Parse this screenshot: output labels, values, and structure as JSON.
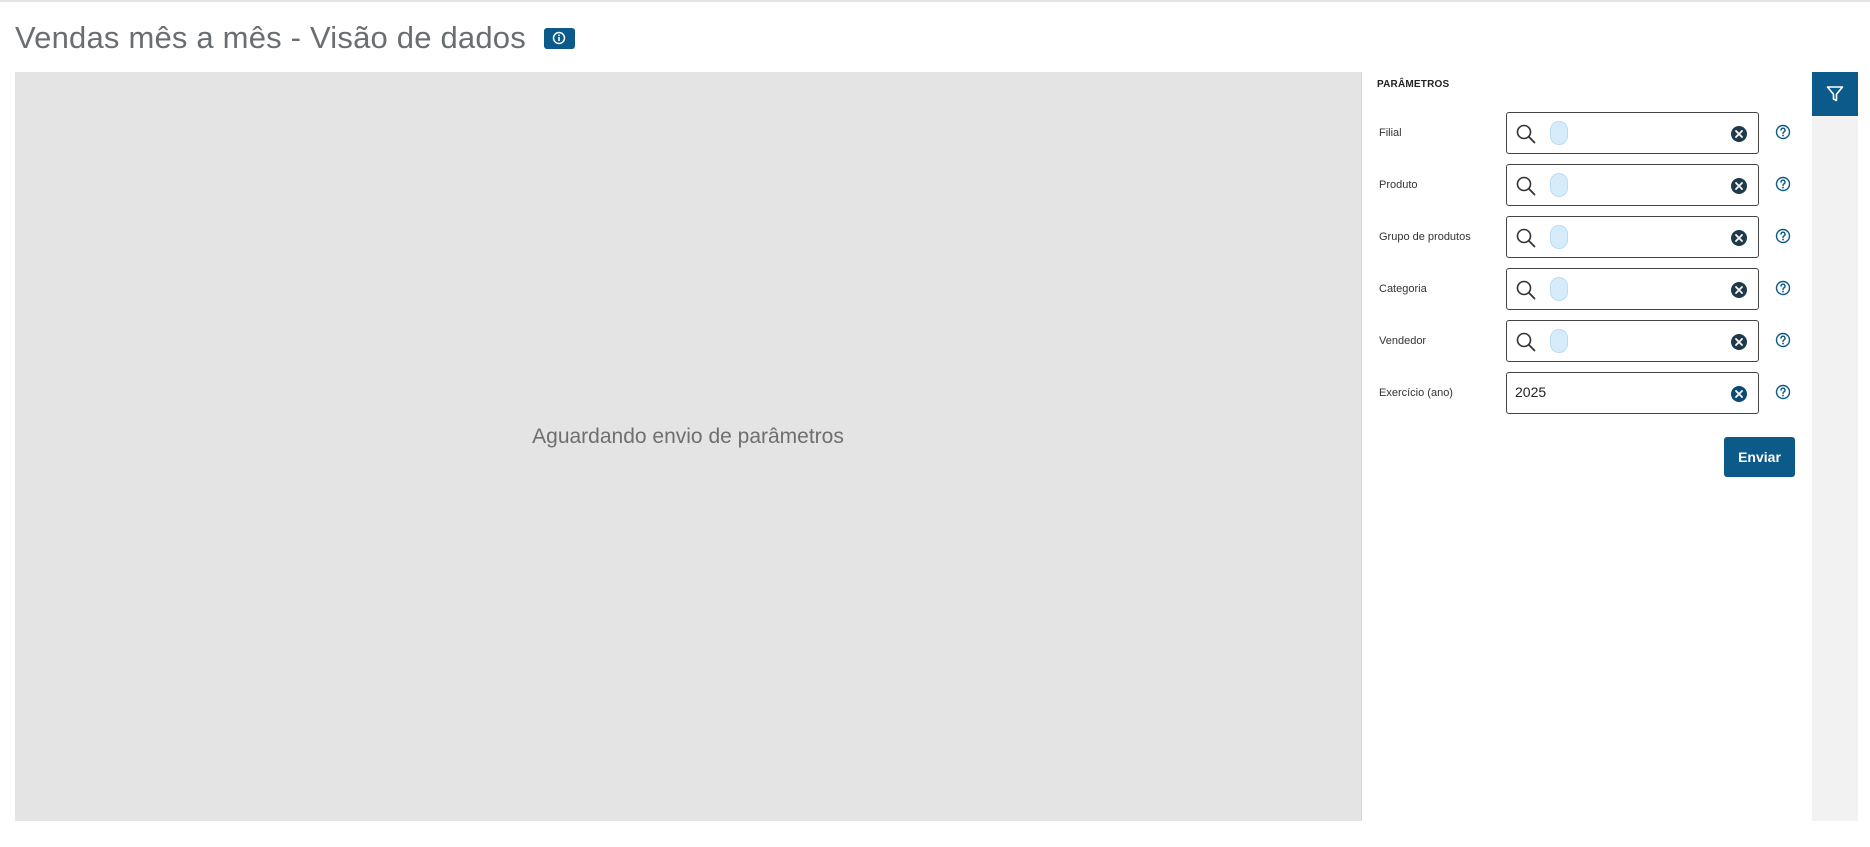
{
  "page": {
    "title": "Vendas mês a mês - Visão de dados",
    "info_icon": "info-icon"
  },
  "preview": {
    "message": "Aguardando envio de parâmetros"
  },
  "parameters": {
    "heading": "PARÂMETROS",
    "fields": [
      {
        "label": "Filial",
        "type": "lookup",
        "value": ""
      },
      {
        "label": "Produto",
        "type": "lookup",
        "value": ""
      },
      {
        "label": "Grupo de produtos",
        "type": "lookup",
        "value": ""
      },
      {
        "label": "Categoria",
        "type": "lookup",
        "value": ""
      },
      {
        "label": "Vendedor",
        "type": "lookup",
        "value": ""
      },
      {
        "label": "Exercício (ano)",
        "type": "text",
        "value": "2025"
      }
    ],
    "submit_label": "Enviar"
  },
  "sidebar": {
    "filter_icon": "filter-icon"
  },
  "colors": {
    "accent": "#0b5a8a",
    "preview_bg": "#e4e4e4",
    "token_bg": "#d7ecfb"
  }
}
